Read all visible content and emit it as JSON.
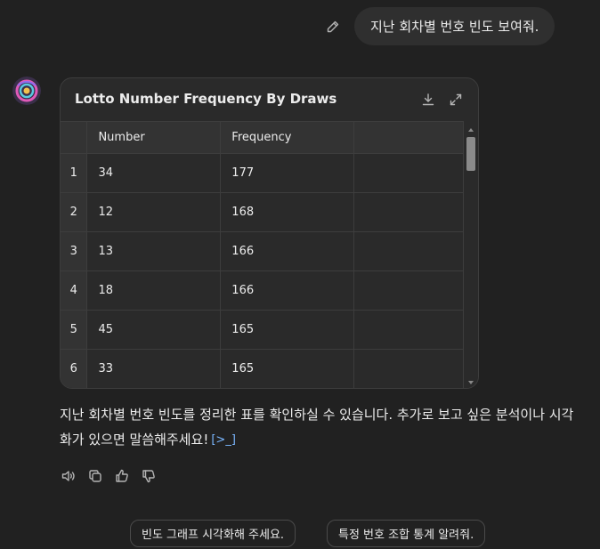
{
  "user_message": "지난 회차별 번호 빈도 보여줘.",
  "table_card": {
    "title": "Lotto Number Frequency By Draws",
    "columns": [
      "",
      "Number",
      "Frequency",
      ""
    ],
    "rows": [
      {
        "index": "1",
        "number": "34",
        "frequency": "177"
      },
      {
        "index": "2",
        "number": "12",
        "frequency": "168"
      },
      {
        "index": "3",
        "number": "13",
        "frequency": "166"
      },
      {
        "index": "4",
        "number": "18",
        "frequency": "166"
      },
      {
        "index": "5",
        "number": "45",
        "frequency": "165"
      },
      {
        "index": "6",
        "number": "33",
        "frequency": "165"
      }
    ]
  },
  "assistant_reply": {
    "text": "지난 회차별 번호 빈도를 정리한 표를 확인하실 수 있습니다. 추가로 보고 싶은 분석이나 시각화가 있으면 말씀해주세요!",
    "link_glyph": "[>_]"
  },
  "icons": {
    "edit": "pencil-icon",
    "download": "download-icon",
    "expand": "expand-icon",
    "read_aloud": "speaker-icon",
    "copy": "copy-icon",
    "like": "thumbs-up-icon",
    "dislike": "thumbs-down-icon"
  },
  "suggestions": [
    "빈도 그래프 시각화해 주세요.",
    "특정 번호 조합 통계 알려줘."
  ]
}
